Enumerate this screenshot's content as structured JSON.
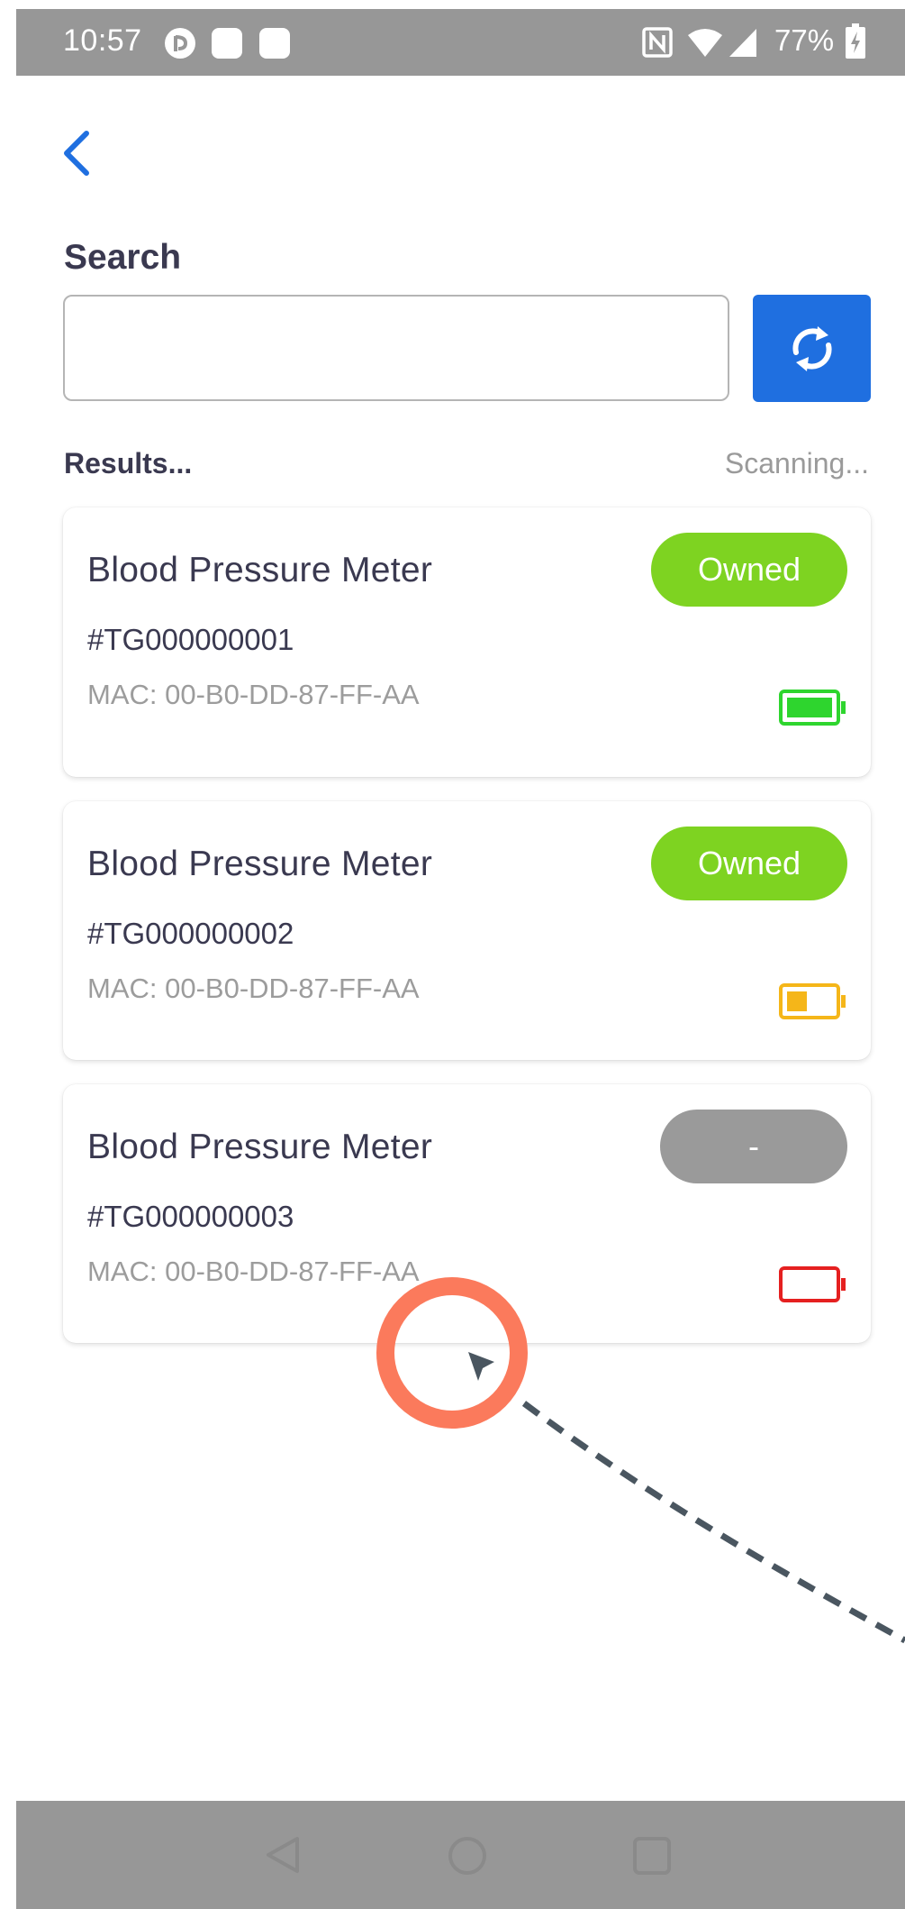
{
  "status_bar": {
    "time": "10:57",
    "battery_percent": "77%",
    "icons": [
      "app-notification-icon",
      "square-notification-icon",
      "square-notification-icon",
      "nfc-icon",
      "wifi-icon",
      "cell-signal-icon",
      "battery-charging-icon"
    ]
  },
  "header": {
    "back_icon": "chevron-left-icon"
  },
  "search": {
    "label": "Search",
    "value": "",
    "placeholder": "",
    "refresh_icon": "refresh-icon"
  },
  "results": {
    "label": "Results...",
    "status": "Scanning...",
    "devices": [
      {
        "name": "Blood Pressure Meter",
        "id": "#TG000000001",
        "mac": "MAC: 00-B0-DD-87-FF-AA",
        "badge": "Owned",
        "battery": {
          "level": "full",
          "color": "#2ed52e"
        }
      },
      {
        "name": "Blood Pressure Meter",
        "id": "#TG000000002",
        "mac": "MAC: 00-B0-DD-87-FF-AA",
        "badge": "Owned",
        "battery": {
          "level": "half",
          "color": "#f5b619"
        }
      },
      {
        "name": "Blood Pressure Meter",
        "id": "#TG000000003",
        "mac": "MAC: 00-B0-DD-87-FF-AA",
        "badge": "-",
        "battery": {
          "level": "empty",
          "color": "#e52020"
        }
      }
    ]
  },
  "nav_bar": {
    "icons": [
      "back-triangle-icon",
      "home-circle-icon",
      "recents-square-icon"
    ]
  },
  "colors": {
    "accent": "#1f6fe0",
    "owned_badge": "#7ed321",
    "neutral_badge": "#9a9a9a",
    "tap_indicator": "#fb7a5c",
    "system_bars": "#979797"
  }
}
